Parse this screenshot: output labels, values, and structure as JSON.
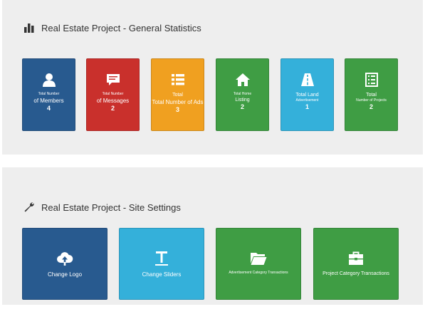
{
  "stats_panel": {
    "title": "Real Estate Project - General Statistics",
    "icon": "bar-chart-icon",
    "tiles": [
      {
        "icon": "user-icon",
        "line1": "Total Number",
        "line2": "of Members",
        "count": "4",
        "color": "#285a8f"
      },
      {
        "icon": "message-icon",
        "line1": "Total Number",
        "line2": "of Messages",
        "count": "2",
        "color": "#c9302c"
      },
      {
        "icon": "list-icon",
        "line1": "Total",
        "line2": "Total Number of Ads",
        "count": "3",
        "color": "#f0a020"
      },
      {
        "icon": "home-icon",
        "line1": "Total Home",
        "line2": "Listing",
        "count": "2",
        "color": "#3f9d44"
      },
      {
        "icon": "road-icon",
        "line1": "Total Land",
        "line2": "Advertisement",
        "count": "1",
        "color": "#34b0da"
      },
      {
        "icon": "document-icon",
        "line1": "Total",
        "line2": "Number of Projects",
        "count": "2",
        "color": "#3f9d44"
      }
    ]
  },
  "settings_panel": {
    "title": "Real Estate Project - Site Settings",
    "icon": "wrench-icon",
    "tiles": [
      {
        "icon": "cloud-upload-icon",
        "label": "Change Logo",
        "color": "#285a8f"
      },
      {
        "icon": "text-icon",
        "label": "Change Sliders",
        "color": "#34b0da"
      },
      {
        "icon": "folder-open-icon",
        "label": "Advertisement Category Transactions",
        "color": "#3f9d44"
      },
      {
        "icon": "briefcase-icon",
        "label": "Project Category Transactions",
        "color": "#3f9d44"
      }
    ]
  }
}
